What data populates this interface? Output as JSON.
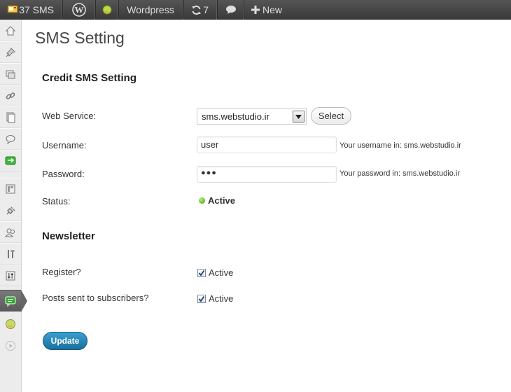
{
  "adminbar": {
    "sms_count": "37 SMS",
    "site_name": "Wordpress",
    "updates": "7",
    "new_label": "New"
  },
  "menu": {
    "icons": [
      "dashboard-icon",
      "posts-icon",
      "media-icon",
      "links-icon",
      "pages-icon",
      "comments-icon",
      "feedback-icon",
      "appearance-icon",
      "plugins-icon",
      "users-icon",
      "tools-icon",
      "settings-icon",
      "sms-icon",
      "plugin-ball-icon",
      "play-icon"
    ]
  },
  "page": {
    "title": "SMS Setting"
  },
  "credit": {
    "heading": "Credit SMS Setting",
    "web_service_label": "Web Service:",
    "web_service_value": "sms.webstudio.ir",
    "select_button": "Select",
    "username_label": "Username:",
    "username_value": "user",
    "username_hint": "Your username in: sms.webstudio.ir",
    "password_label": "Password:",
    "password_value": "●●●",
    "password_hint": "Your password in: sms.webstudio.ir",
    "status_label": "Status:",
    "status_value": "Active"
  },
  "newsletter": {
    "heading": "Newsletter",
    "register_label": "Register?",
    "register_check": "Active",
    "posts_label": "Posts sent to subscribers?",
    "posts_check": "Active"
  },
  "update_button": "Update",
  "colors": {
    "adminbar": "#464646",
    "button_primary": "#21759b",
    "status_active": "#3a9f12"
  }
}
